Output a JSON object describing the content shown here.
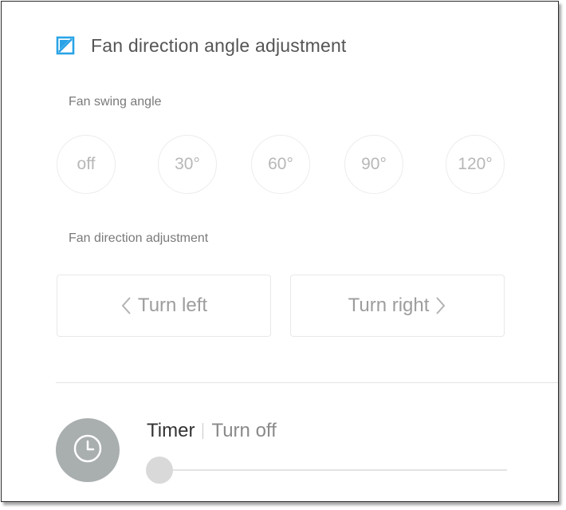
{
  "header": {
    "title": "Fan direction angle adjustment",
    "icon": "direction-square-icon",
    "accent_color": "#29a3e6"
  },
  "swing": {
    "label": "Fan swing angle",
    "options": [
      "off",
      "30°",
      "60°",
      "90°",
      "120°"
    ]
  },
  "direction": {
    "label": "Fan direction adjustment",
    "left_label": "Turn left",
    "right_label": "Turn right"
  },
  "timer": {
    "title": "Timer",
    "status": "Turn off",
    "icon": "clock-icon",
    "value_fraction": 0
  }
}
